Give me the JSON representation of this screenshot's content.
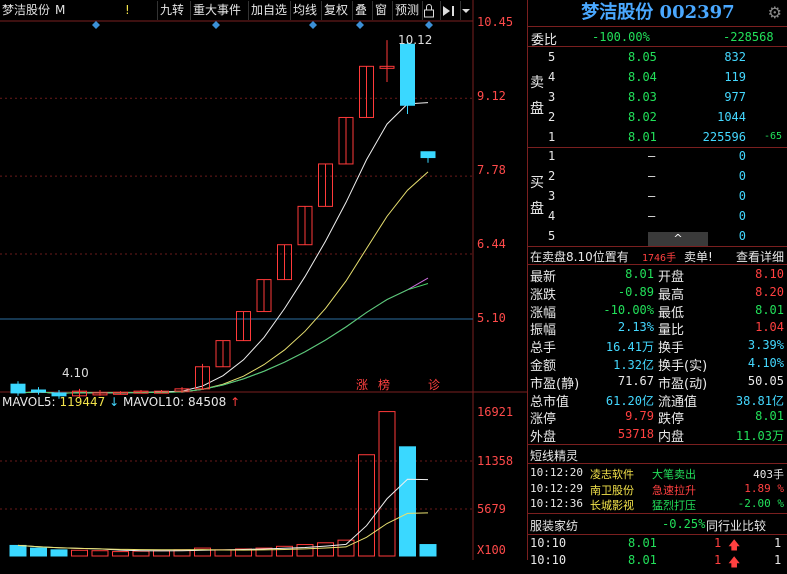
{
  "toolbar": {
    "stock_label": "梦洁股份",
    "stock_suffix": "M",
    "warn": "!",
    "buttons": [
      "九转",
      "重大事件",
      "加自选",
      "均线",
      "复权",
      "叠",
      "窗",
      "预测"
    ]
  },
  "price_axis": [
    "10.45",
    "9.12",
    "7.78",
    "6.44",
    "5.10"
  ],
  "annotations": {
    "high": "10.12",
    "low": "4.10",
    "zhang": "涨",
    "bang": "榜",
    "zhen": "诊"
  },
  "vol_header": {
    "mavol5_label": "MAVOL5:",
    "mavol5_value": "119447",
    "mavol10_label": "MAVOL10:",
    "mavol10_value": "84508"
  },
  "vol_axis": [
    "16921",
    "11358",
    "5679",
    "X100"
  ],
  "chart_data": {
    "type": "candlestick",
    "ylim": [
      4.1,
      10.45
    ],
    "candles": [
      {
        "o": 4.2,
        "c": 4.05,
        "h": 4.25,
        "l": 4.0
      },
      {
        "o": 4.1,
        "c": 4.08,
        "h": 4.15,
        "l": 4.02
      },
      {
        "o": 4.05,
        "c": 4.0,
        "h": 4.1,
        "l": 3.95
      },
      {
        "o": 4.0,
        "c": 4.08,
        "h": 4.12,
        "l": 3.98
      },
      {
        "o": 4.05,
        "c": 4.05,
        "h": 4.1,
        "l": 4.0
      },
      {
        "o": 4.05,
        "c": 4.06,
        "h": 4.08,
        "l": 4.02
      },
      {
        "o": 4.06,
        "c": 4.08,
        "h": 4.1,
        "l": 4.04
      },
      {
        "o": 4.08,
        "c": 4.08,
        "h": 4.1,
        "l": 4.06
      },
      {
        "o": 4.08,
        "c": 4.12,
        "h": 4.15,
        "l": 4.05
      },
      {
        "o": 4.12,
        "c": 4.5,
        "h": 4.55,
        "l": 4.1
      },
      {
        "o": 4.5,
        "c": 4.95,
        "h": 4.95,
        "l": 4.5
      },
      {
        "o": 4.95,
        "c": 5.45,
        "h": 5.45,
        "l": 4.95
      },
      {
        "o": 5.45,
        "c": 6.0,
        "h": 6.0,
        "l": 5.45
      },
      {
        "o": 6.0,
        "c": 6.6,
        "h": 6.6,
        "l": 6.0
      },
      {
        "o": 6.6,
        "c": 7.26,
        "h": 7.26,
        "l": 6.6
      },
      {
        "o": 7.26,
        "c": 7.99,
        "h": 7.99,
        "l": 7.26
      },
      {
        "o": 7.99,
        "c": 8.79,
        "h": 8.79,
        "l": 7.99
      },
      {
        "o": 8.79,
        "c": 9.67,
        "h": 9.67,
        "l": 8.79
      },
      {
        "o": 9.67,
        "c": 9.67,
        "h": 10.12,
        "l": 9.4
      },
      {
        "o": 10.05,
        "c": 9.0,
        "h": 10.12,
        "l": 8.85
      },
      {
        "o": 8.2,
        "c": 8.1,
        "h": 8.2,
        "l": 8.01
      }
    ],
    "volumes": [
      1200,
      900,
      700,
      650,
      600,
      500,
      550,
      600,
      700,
      900,
      700,
      800,
      900,
      1100,
      1300,
      1500,
      1800,
      11500,
      16400,
      12400,
      1300
    ],
    "vol_ylim": [
      0,
      16921
    ]
  },
  "panel": {
    "title": "梦洁股份 002397",
    "weibi_label": "委比",
    "weibi_pct": "-100.00%",
    "weibi_val": "-228568",
    "sell_label": "卖盘",
    "buy_label": "买盘",
    "sell": [
      {
        "lvl": "5",
        "price": "8.05",
        "vol": "832"
      },
      {
        "lvl": "4",
        "price": "8.04",
        "vol": "119"
      },
      {
        "lvl": "3",
        "price": "8.03",
        "vol": "977"
      },
      {
        "lvl": "2",
        "price": "8.02",
        "vol": "1044"
      },
      {
        "lvl": "1",
        "price": "8.01",
        "vol": "225596",
        "chg": "-65"
      }
    ],
    "buy": [
      {
        "lvl": "1",
        "price": "–",
        "vol": "0"
      },
      {
        "lvl": "2",
        "price": "–",
        "vol": "0"
      },
      {
        "lvl": "3",
        "price": "–",
        "vol": "0"
      },
      {
        "lvl": "4",
        "price": "–",
        "vol": "0"
      },
      {
        "lvl": "5",
        "price": "–",
        "vol": "0"
      }
    ],
    "queue_text": "在卖盘8.10位置有",
    "queue_vol": "1746手",
    "queue_tag": "卖单!",
    "detail": "查看详细",
    "stats": [
      {
        "l1": "最新",
        "v1": "8.01",
        "c1": "green",
        "l2": "开盘",
        "v2": "8.10",
        "c2": "red"
      },
      {
        "l1": "涨跌",
        "v1": "-0.89",
        "c1": "green",
        "l2": "最高",
        "v2": "8.20",
        "c2": "red"
      },
      {
        "l1": "涨幅",
        "v1": "-10.00%",
        "c1": "green",
        "l2": "最低",
        "v2": "8.01",
        "c2": "green"
      },
      {
        "l1": "振幅",
        "v1": "2.13%",
        "c1": "cyan",
        "l2": "量比",
        "v2": "1.04",
        "c2": "red"
      },
      {
        "l1": "总手",
        "v1": "16.41万",
        "c1": "cyan",
        "l2": "换手",
        "v2": "3.39%",
        "c2": "cyan"
      },
      {
        "l1": "金额",
        "v1": "1.32亿",
        "c1": "cyan",
        "l2": "换手(实)",
        "v2": "4.10%",
        "c2": "cyan"
      },
      {
        "l1": "市盈(静)",
        "v1": "71.67",
        "c1": "white",
        "l2": "市盈(动)",
        "v2": "50.05",
        "c2": "white"
      },
      {
        "l1": "总市值",
        "v1": "61.20亿",
        "c1": "cyan",
        "l2": "流通值",
        "v2": "38.81亿",
        "c2": "cyan"
      },
      {
        "l1": "涨停",
        "v1": "9.79",
        "c1": "red",
        "l2": "跌停",
        "v2": "8.01",
        "c2": "green"
      },
      {
        "l1": "外盘",
        "v1": "53718",
        "c1": "red",
        "l2": "内盘",
        "v2": "11.03万",
        "c2": "green"
      }
    ],
    "short_title": "短线精灵",
    "short": [
      {
        "t": "10:12:20",
        "name": "凌志软件",
        "ev": "大笔卖出",
        "val": "403手",
        "vc": "white"
      },
      {
        "t": "10:12:29",
        "name": "南卫股份",
        "ev": "急速拉升",
        "val": "1.89 %",
        "vc": "red"
      },
      {
        "t": "10:12:36",
        "name": "长城影视",
        "ev": "猛烈打压",
        "val": "-2.00 %",
        "vc": "green"
      }
    ],
    "sector_name": "服装家纺",
    "sector_pct": "-0.25%",
    "compare": "同行业比较",
    "ticks": [
      {
        "t": "10:10",
        "p": "8.01",
        "v": "1",
        "arrow": "up"
      },
      {
        "t": "10:10",
        "p": "8.01",
        "v": "1",
        "arrow": "up"
      }
    ],
    "colors": {
      "up": "#ff4040",
      "down": "#22e05a",
      "accent": "#4aa8ff",
      "border": "#7a1f1f"
    }
  }
}
